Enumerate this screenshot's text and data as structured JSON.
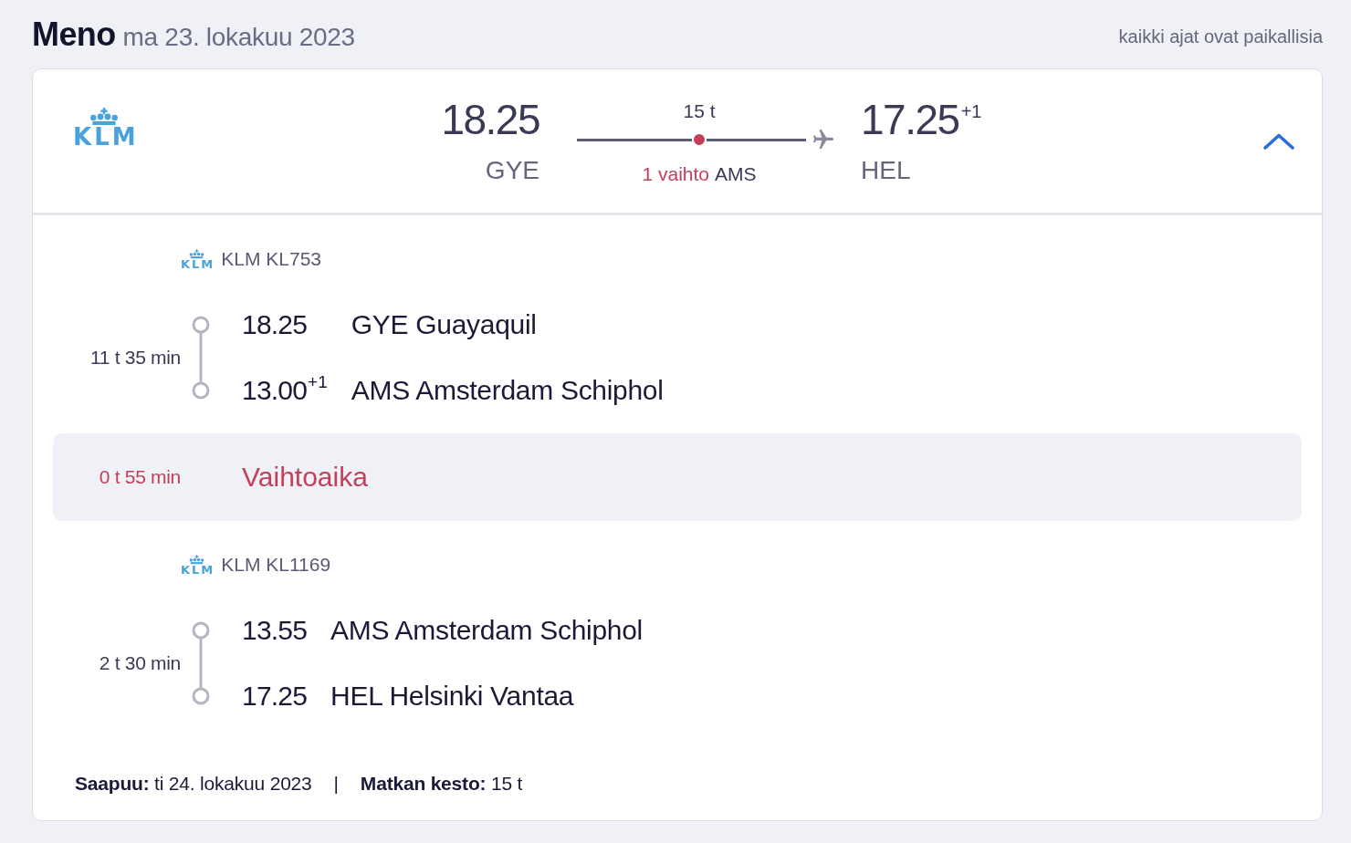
{
  "heading": {
    "title": "Meno",
    "date": "ma 23. lokakuu 2023",
    "note": "kaikki ajat ovat paikallisia"
  },
  "summary": {
    "airline_logo": "KLM",
    "departure": {
      "time": "18.25",
      "airport": "GYE"
    },
    "duration": "15 t",
    "stops": "1 vaihto",
    "stop_airport": "AMS",
    "arrival": {
      "time": "17.25$^{+1}$",
      "airport": "HEL"
    },
    "expanded": true
  },
  "segments": [
    {
      "kind": "flight",
      "airline_logo": "KLM",
      "flight": "KLM KL753",
      "duration": "11 t 35 min",
      "stops": [
        {
          "time": "18.25",
          "place": "GYE Guayaquil"
        },
        {
          "time": "13.00$^{+1}$",
          "place": "AMS Amsterdam Schiphol"
        }
      ]
    },
    {
      "kind": "layover",
      "duration": "0 t 55 min",
      "label": "Vaihtoaika"
    },
    {
      "kind": "flight",
      "airline_logo": "KLM",
      "flight": "KLM KL1169",
      "duration": "2 t 30 min",
      "stops": [
        {
          "time": "13.55",
          "place": "AMS Amsterdam Schiphol"
        },
        {
          "time": "17.25",
          "place": "HEL Helsinki Vantaa"
        }
      ]
    }
  ],
  "footer": {
    "arrival": "**Saapuu:** ti 24. lokakuu 2023",
    "separator": "|",
    "trip_duration": "**Matkan kesto:** 15 t"
  }
}
